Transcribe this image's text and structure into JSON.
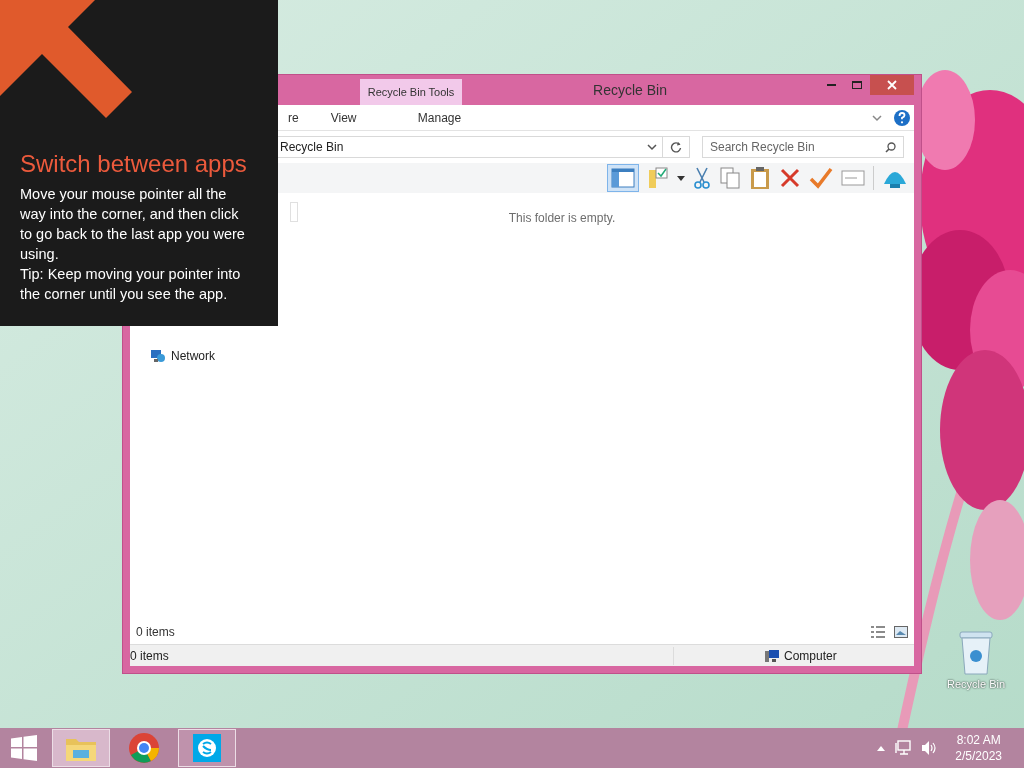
{
  "overlay": {
    "title": "Switch between apps",
    "body": "Move your mouse pointer all the way into the corner, and then click to go back to the last app you were using.",
    "tip": "Tip: Keep moving your pointer into the corner until you see the app."
  },
  "window": {
    "title": "Recycle Bin",
    "contextual_tab": "Recycle Bin Tools",
    "tabs": [
      {
        "label": "re",
        "selected": false
      },
      {
        "label": "View",
        "selected": false
      },
      {
        "label": "Manage",
        "selected": false
      }
    ],
    "address": "Recycle Bin",
    "search": {
      "placeholder": "Search Recycle Bin"
    },
    "nav": [
      {
        "label": "Network"
      }
    ],
    "empty_message": "This folder is empty.",
    "item_count": "0 items",
    "status_bar": {
      "items": "0 items",
      "location": "Computer"
    }
  },
  "taskbar": {
    "apps": [
      {
        "kind": "explorer",
        "selected": true,
        "running": true
      },
      {
        "kind": "chrome",
        "selected": false,
        "running": false
      },
      {
        "kind": "skype",
        "selected": false,
        "running": true
      }
    ],
    "time": "8:02 AM",
    "date": "2/5/2023"
  },
  "desktop_icons": [
    {
      "label": "Recycle Bin"
    }
  ]
}
